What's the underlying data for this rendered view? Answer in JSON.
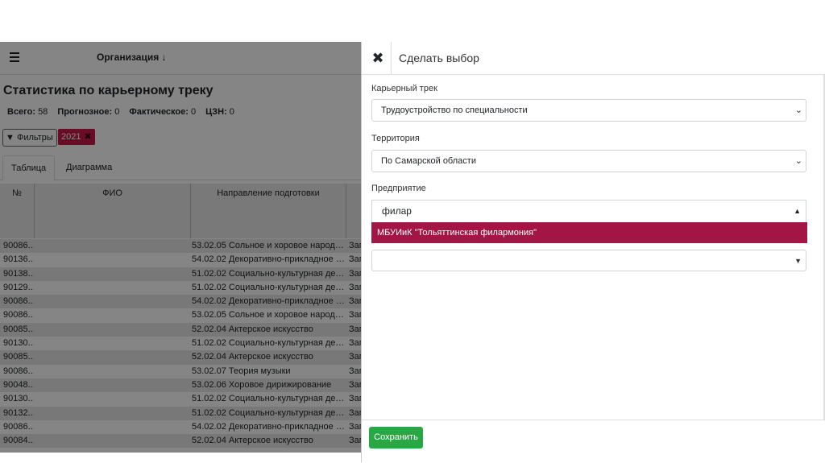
{
  "background": {
    "org_label": "Организация ↓",
    "page_title": "Статистика по карьерному треку",
    "stats": {
      "total_label": "Всего:",
      "total_value": "58",
      "forecast_label": "Прогнозное:",
      "forecast_value": "0",
      "actual_label": "Фактическое:",
      "actual_value": "0",
      "czn_label": "ЦЗН:",
      "czn_value": "0"
    },
    "filters_label": "Фильтры",
    "year_chip": "2021",
    "tabs": [
      "Таблица",
      "Диаграмма"
    ],
    "columns": [
      "№",
      "ФИО",
      "Направление подготовки"
    ],
    "rows": [
      {
        "id": "90086...",
        "dir": "53.02.05 Сольное и хоровое народное...",
        "c4": "Зап"
      },
      {
        "id": "90136...",
        "dir": "54.02.02 Декоративно-прикладное иск...",
        "c4": "Зап"
      },
      {
        "id": "90138...",
        "dir": "51.02.02 Социально-культурная деятел...",
        "c4": "Зап"
      },
      {
        "id": "90129...",
        "dir": "51.02.02 Социально-культурная деятел...",
        "c4": "Зап"
      },
      {
        "id": "90086...",
        "dir": "54.02.02 Декоративно-прикладное иск...",
        "c4": "Зап"
      },
      {
        "id": "90086...",
        "dir": "53.02.05 Сольное и хоровое народное...",
        "c4": "Зап"
      },
      {
        "id": "90085...",
        "dir": "52.02.04 Актерское искусство",
        "c4": "Зап"
      },
      {
        "id": "90130...",
        "dir": "51.02.02 Социально-культурная деятел...",
        "c4": "Зап"
      },
      {
        "id": "90085...",
        "dir": "52.02.04 Актерское искусство",
        "c4": "Зап"
      },
      {
        "id": "90086...",
        "dir": "53.02.07 Теория музыки",
        "c4": "Зап"
      },
      {
        "id": "90048...",
        "dir": "53.02.06 Хоровое дирижирование",
        "c4": "Зап"
      },
      {
        "id": "90130...",
        "dir": "51.02.02 Социально-культурная деятел...",
        "c4": "Зап"
      },
      {
        "id": "90132...",
        "dir": "51.02.02 Социально-культурная деятел...",
        "c4": "Зап"
      },
      {
        "id": "90086...",
        "dir": "54.02.02 Декоративно-прикладное иск...",
        "c4": "Зап"
      },
      {
        "id": "90084...",
        "dir": "52.02.04 Актерское искусство",
        "c4": "Зап"
      }
    ]
  },
  "panel": {
    "title": "Сделать выбор",
    "career_label": "Карьерный трек",
    "career_value": "Трудоустройство по специальности",
    "territory_label": "Территория",
    "territory_value": "По Самарской области",
    "enterprise_label": "Предприятие",
    "search_value": "филар",
    "option_text": "МБУИиК \"Тольяттинская филармония\"",
    "save_label": "Сохранить"
  },
  "colors": {
    "accent": "#a31545",
    "save": "#28a745",
    "chip": "#c9184a"
  }
}
